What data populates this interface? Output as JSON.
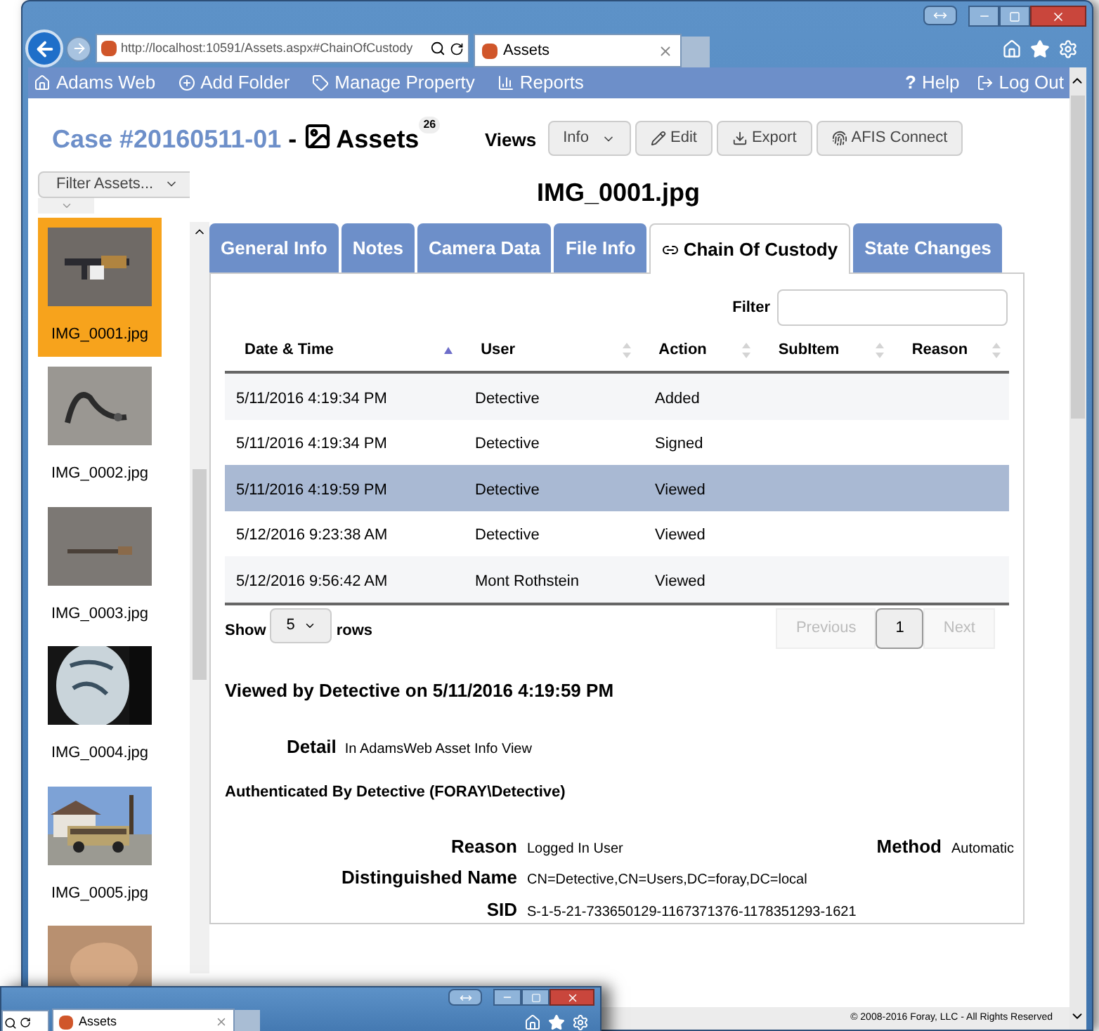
{
  "browser": {
    "url": "http://localhost:10591/Assets.aspx#ChainOfCustody",
    "tab": "Assets"
  },
  "nav": {
    "left": [
      {
        "label": "Adams Web",
        "kind": "home"
      },
      {
        "label": "Add Folder",
        "kind": "add"
      },
      {
        "label": "Manage Property",
        "kind": "tag"
      },
      {
        "label": "Reports",
        "kind": "chart"
      }
    ],
    "right": [
      {
        "label": "Help",
        "kind": "help",
        "icon": "?"
      },
      {
        "label": "Log Out",
        "kind": "logout"
      }
    ]
  },
  "header": {
    "case": "Case #20160511-01",
    "separator": "-",
    "title": "Assets",
    "count": "26",
    "views_label": "Views",
    "view_buttons": [
      {
        "label": "Info",
        "kind": "dropdown"
      },
      {
        "label": "Edit",
        "kind": "edit"
      },
      {
        "label": "Export",
        "kind": "export"
      },
      {
        "label": "AFIS Connect",
        "kind": "afis"
      }
    ]
  },
  "filter_button": "Filter Assets...",
  "asset_title": "IMG_0001.jpg",
  "thumbnails": [
    {
      "name": "IMG_0001.jpg",
      "selected": true
    },
    {
      "name": "IMG_0002.jpg",
      "selected": false
    },
    {
      "name": "IMG_0003.jpg",
      "selected": false
    },
    {
      "name": "IMG_0004.jpg",
      "selected": false
    },
    {
      "name": "IMG_0005.jpg",
      "selected": false
    },
    {
      "kind": "picture"
    }
  ],
  "tabs": [
    {
      "label": "General Info",
      "selected": false
    },
    {
      "label": "Notes",
      "selected": false
    },
    {
      "label": "Camera Data",
      "selected": false
    },
    {
      "label": "File Info",
      "selected": false
    },
    {
      "label": "Chain Of Custody",
      "selected": true
    },
    {
      "label": "State Changes",
      "selected": false
    }
  ],
  "table": {
    "filter_label": "Filter",
    "columns": [
      {
        "label": "Date & Time",
        "sorted": true
      },
      {
        "label": "User",
        "sorted": false
      },
      {
        "label": "Action",
        "sorted": false
      },
      {
        "label": "SubItem",
        "sorted": false
      },
      {
        "label": "Reason",
        "sorted": false
      }
    ],
    "rows": [
      {
        "cells": [
          "5/11/2016 4:19:34 PM",
          "Detective",
          "Added"
        ],
        "selected": false
      },
      {
        "cells": [
          "5/11/2016 4:19:34 PM",
          "Detective",
          "Signed"
        ],
        "selected": false
      },
      {
        "cells": [
          "5/11/2016 4:19:59 PM",
          "Detective",
          "Viewed"
        ],
        "selected": true
      },
      {
        "cells": [
          "5/12/2016 9:23:38 AM",
          "Detective",
          "Viewed"
        ],
        "selected": false
      },
      {
        "cells": [
          "5/12/2016 9:56:42 AM",
          "Mont Rothstein",
          "Viewed"
        ],
        "selected": false
      }
    ],
    "show_label": "Show",
    "page_size": "5",
    "rows_label": "rows",
    "pager": [
      {
        "label": "Previous",
        "kind": "disabled"
      },
      {
        "label": "1",
        "kind": "current"
      },
      {
        "label": "Next",
        "kind": "disabled"
      }
    ]
  },
  "detail": {
    "heading": "Viewed by Detective on 5/11/2016 4:19:59 PM",
    "detail_label": "Detail",
    "detail_value": "In AdamsWeb Asset Info View",
    "auth_heading": "Authenticated By Detective (FORAY\\Detective)",
    "fields": [
      [
        {
          "label": "Reason",
          "value": "Logged In User"
        },
        {
          "label": "Method",
          "value": "Automatic"
        }
      ],
      [
        {
          "label": "Distinguished Name",
          "value": "CN=Detective,CN=Users,DC=foray,DC=local"
        }
      ],
      [
        {
          "label": "SID",
          "value": "S-1-5-21-733650129-1167371376-1178351293-1621"
        }
      ]
    ]
  },
  "footer": "© 2008-2016 Foray, LLC - All Rights Reserved",
  "second_window": {
    "tab": "Assets"
  }
}
